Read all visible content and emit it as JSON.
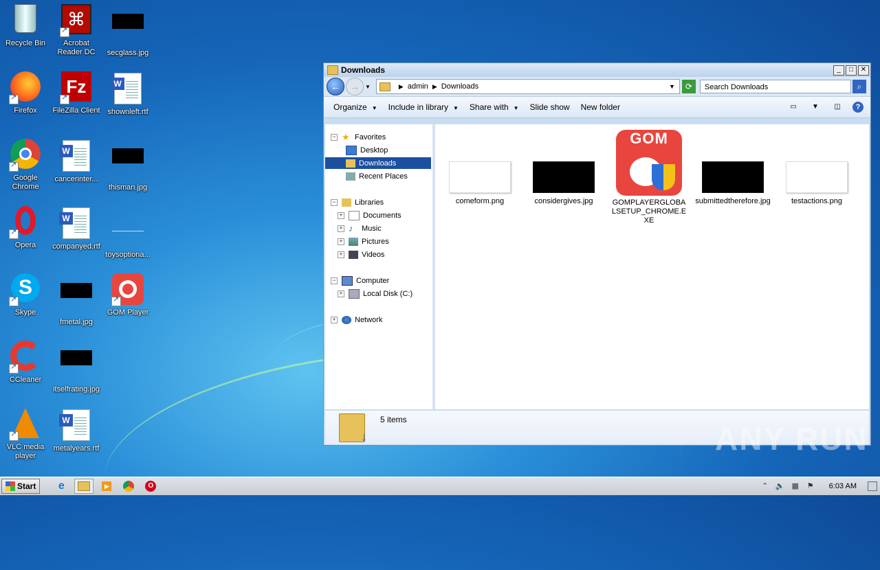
{
  "desktop": {
    "icons": [
      {
        "label": "Recycle Bin",
        "icon": "recycle-bin-icon"
      },
      {
        "label": "Acrobat\nReader DC",
        "icon": "acrobat-icon"
      },
      {
        "label": "secglass.jpg",
        "icon": "image-file-icon"
      },
      {
        "label": "Firefox",
        "icon": "firefox-icon"
      },
      {
        "label": "FileZilla Client",
        "icon": "filezilla-icon"
      },
      {
        "label": "shownleft.rtf",
        "icon": "word-doc-icon"
      },
      {
        "label": "Google\nChrome",
        "icon": "chrome-icon"
      },
      {
        "label": "cancerinter...",
        "icon": "word-doc-icon"
      },
      {
        "label": "thisman.jpg",
        "icon": "image-file-icon"
      },
      {
        "label": "Opera",
        "icon": "opera-icon"
      },
      {
        "label": "companyed.rtf",
        "icon": "word-doc-icon"
      },
      {
        "label": "toysoptiona...",
        "icon": "image-file-icon"
      },
      {
        "label": "Skype",
        "icon": "skype-icon"
      },
      {
        "label": "fmetal.jpg",
        "icon": "image-file-icon"
      },
      {
        "label": "GOM Player",
        "icon": "gom-player-icon"
      },
      {
        "label": "CCleaner",
        "icon": "ccleaner-icon"
      },
      {
        "label": "itselfrating.jpg",
        "icon": "image-file-icon"
      },
      {
        "label": "VLC media\nplayer",
        "icon": "vlc-icon"
      },
      {
        "label": "metalyears.rtf",
        "icon": "word-doc-icon"
      }
    ]
  },
  "window": {
    "title": "Downloads",
    "breadcrumb": [
      "admin",
      "Downloads"
    ],
    "search_placeholder": "Search Downloads",
    "toolbar": {
      "organize": "Organize",
      "include": "Include in library",
      "share": "Share with",
      "slideshow": "Slide show",
      "new_folder": "New folder"
    },
    "nav": {
      "favorites": "Favorites",
      "desktop": "Desktop",
      "downloads": "Downloads",
      "recent": "Recent Places",
      "libraries": "Libraries",
      "documents": "Documents",
      "music": "Music",
      "pictures": "Pictures",
      "videos": "Videos",
      "computer": "Computer",
      "local_disk": "Local Disk (C:)",
      "network": "Network"
    },
    "files": [
      {
        "name": "comeform.png"
      },
      {
        "name": "considergives.jpg"
      },
      {
        "name": "GOMPLAYERGLOBALSETUP_CHROME.EXE"
      },
      {
        "name": "submittedtherefore.jpg"
      },
      {
        "name": "testactions.png"
      }
    ],
    "status": "5 items"
  },
  "taskbar": {
    "start": "Start",
    "clock": "6:03 AM"
  },
  "watermark": "ANY RUN",
  "colors": {
    "accent": "#1c4f9e",
    "gom_red": "#e9453f"
  }
}
